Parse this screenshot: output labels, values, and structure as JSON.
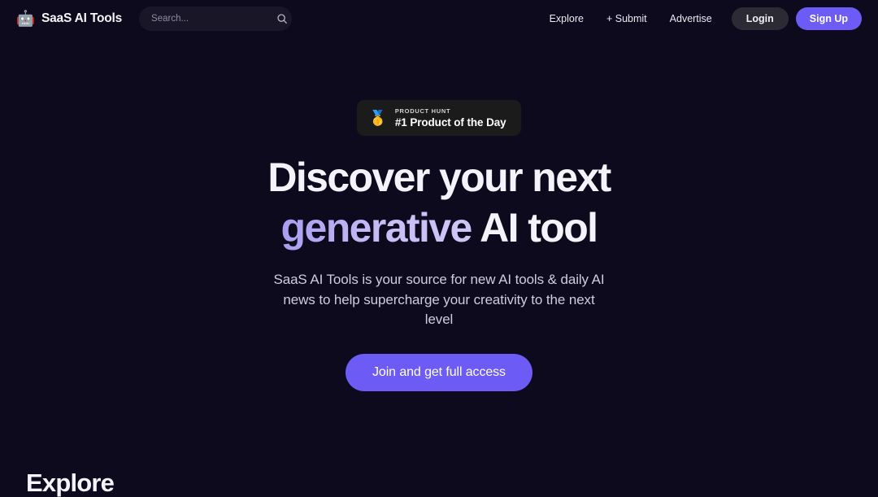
{
  "theme": {
    "background": "#0c0a1c",
    "accent": "#6c5cf5",
    "surface": "#191627",
    "badge_surface": "#1c1b1b",
    "login_surface": "#2c2b35",
    "gradient_from": "#a79cf0",
    "gradient_to": "#cfc6f7"
  },
  "header": {
    "brand": {
      "logo_icon": "robot-icon",
      "logo_glyph": "🤖",
      "name": "SaaS AI Tools"
    },
    "search": {
      "placeholder": "Search...",
      "value": "",
      "icon": "search-icon"
    },
    "nav_links": [
      {
        "label": "Explore",
        "name": "explore"
      },
      {
        "label": "+ Submit",
        "name": "submit"
      },
      {
        "label": "Advertise",
        "name": "advertise"
      }
    ],
    "login_label": "Login",
    "signup_label": "Sign Up"
  },
  "hero": {
    "badge": {
      "medal_icon": "gold-medal-icon",
      "medal_glyph": "🥇",
      "eyebrow": "PRODUCT HUNT",
      "title": "#1 Product of the Day"
    },
    "headline_line1": "Discover your next",
    "headline_gradient_word": "generative",
    "headline_line2_rest": " AI tool",
    "subtitle": "SaaS AI Tools is your source for new AI tools & daily AI news to help supercharge your creativity to the next level",
    "cta_label": "Join and get full access"
  },
  "explore": {
    "heading": "Explore"
  }
}
